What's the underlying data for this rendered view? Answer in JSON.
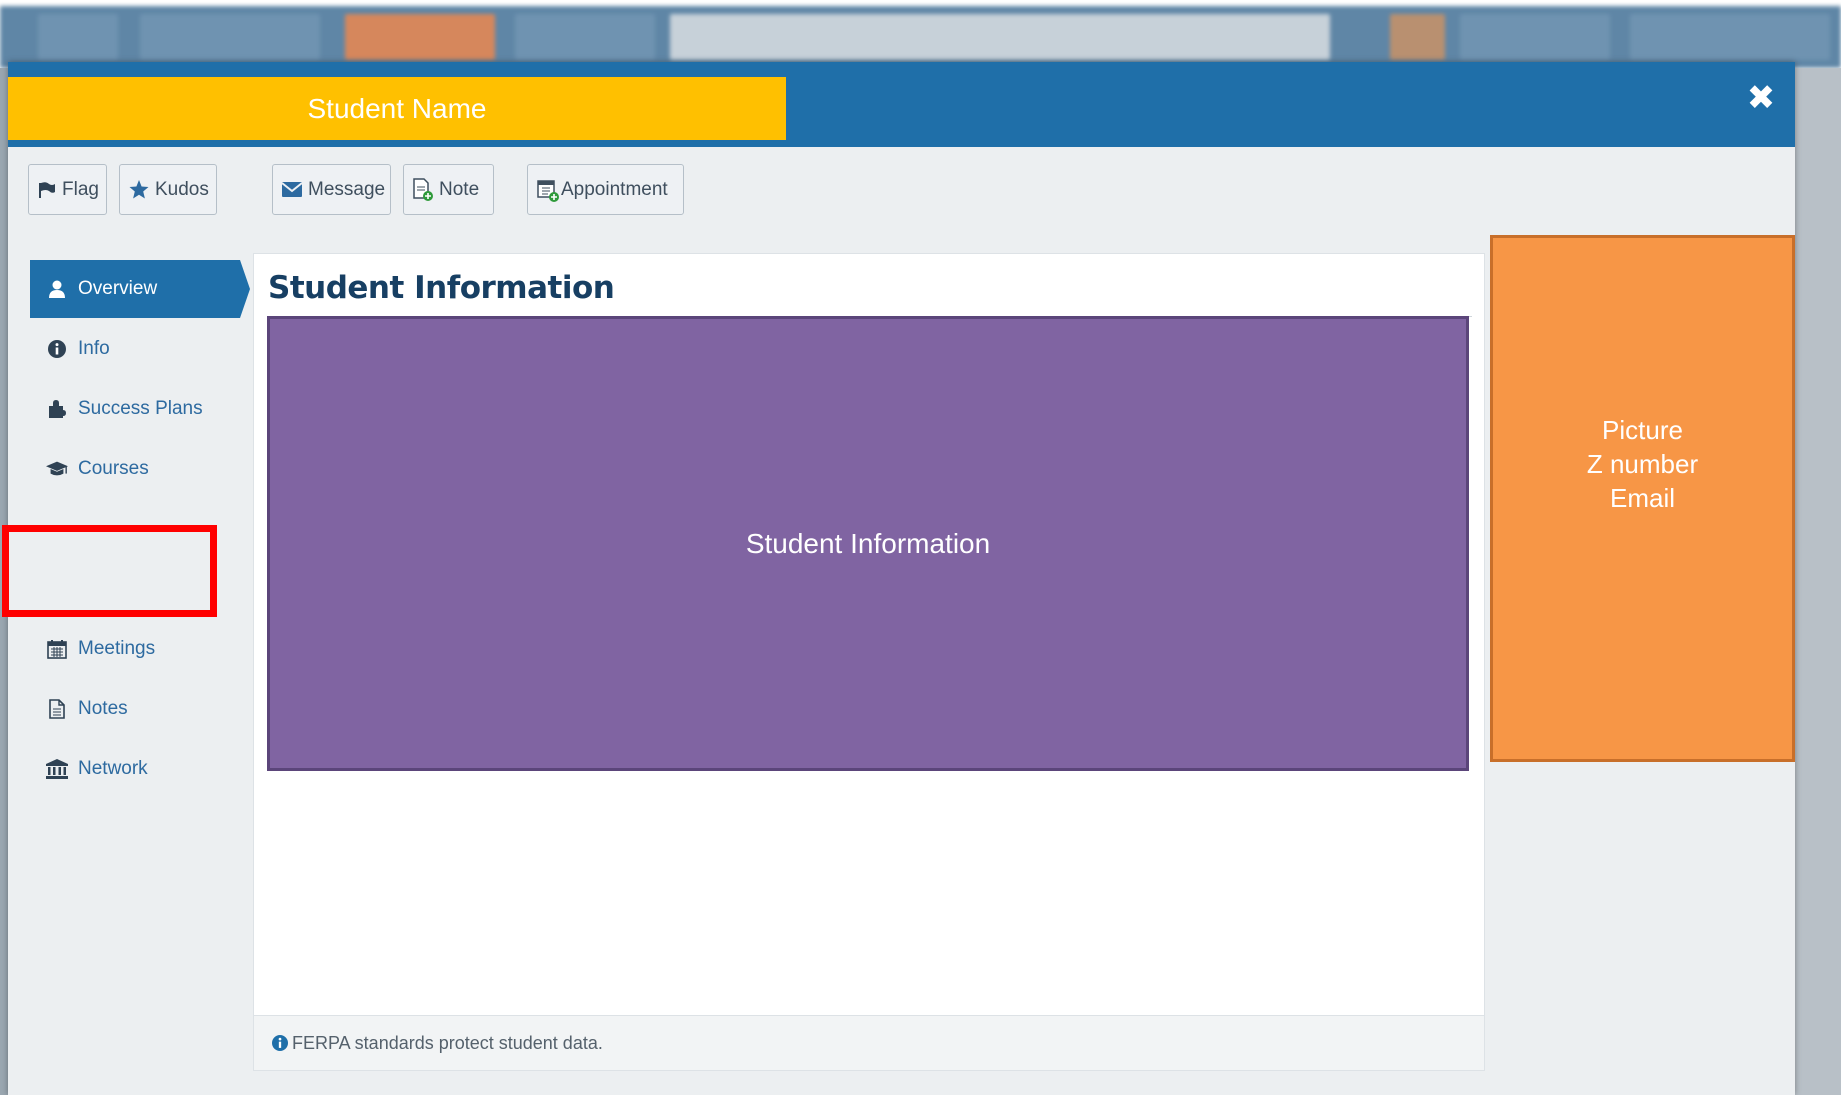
{
  "header": {
    "student_name": "Student Name",
    "close_label": "✖"
  },
  "toolbar": {
    "flag": "Flag",
    "kudos": "Kudos",
    "message": "Message",
    "note": "Note",
    "appointment": "Appointment"
  },
  "sidebar": {
    "items": [
      {
        "label": "Overview",
        "icon": "user-icon",
        "active": true
      },
      {
        "label": "Info",
        "icon": "info-circle-icon"
      },
      {
        "label": "Success Plans",
        "icon": "puzzle-icon"
      },
      {
        "label": "Courses",
        "icon": "graduation-cap-icon"
      },
      {
        "label": "Meetings",
        "icon": "calendar-icon"
      },
      {
        "label": "Notes",
        "icon": "document-icon"
      },
      {
        "label": "Network",
        "icon": "institution-icon"
      }
    ]
  },
  "main": {
    "title": "Student Information",
    "placeholder_text": "Student Information",
    "footer_text": "FERPA standards protect student data."
  },
  "profile_box": {
    "line1": "Picture",
    "line2": "Z number",
    "line3": "Email"
  },
  "colors": {
    "header_blue": "#1f6fa9",
    "name_banner": "#ffc000",
    "student_info_box": "#8064a2",
    "profile_box": "#f79646",
    "highlight": "#ff0000"
  }
}
